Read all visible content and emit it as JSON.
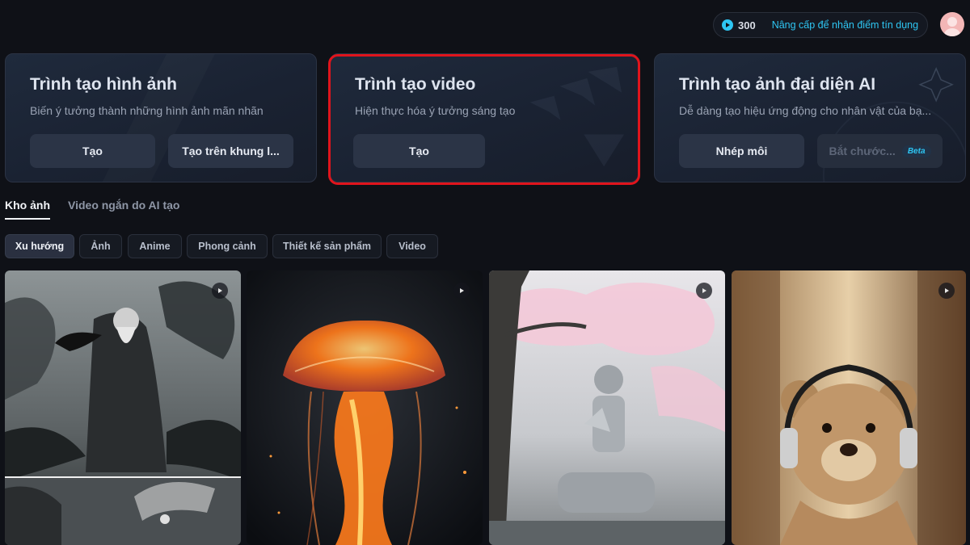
{
  "header": {
    "credits": "300",
    "upgrade_label": "Nâng cấp để nhận điểm tín dụng",
    "icons": {
      "credits": "play-circle-icon",
      "avatar": "user-avatar"
    }
  },
  "cards": [
    {
      "title": "Trình tạo hình ảnh",
      "description": "Biến ý tưởng thành những hình ảnh mãn nhãn",
      "buttons": [
        {
          "label": "Tạo"
        },
        {
          "label": "Tạo trên khung l..."
        }
      ]
    },
    {
      "title": "Trình tạo video",
      "description": "Hiện thực hóa ý tưởng sáng tạo",
      "buttons": [
        {
          "label": "Tạo"
        }
      ],
      "highlighted": true
    },
    {
      "title": "Trình tạo ảnh đại diện AI",
      "description": "Dễ dàng tạo hiệu ứng động cho nhân vật của bạ...",
      "buttons": [
        {
          "label": "Nhép môi"
        },
        {
          "label": "Bắt chước...",
          "badge": "Beta",
          "disabled": true
        }
      ]
    }
  ],
  "tabs": [
    {
      "label": "Kho ảnh",
      "active": true
    },
    {
      "label": "Video ngắn do AI tạo",
      "active": false
    }
  ],
  "filters": [
    {
      "label": "Xu hướng",
      "active": true
    },
    {
      "label": "Ảnh"
    },
    {
      "label": "Anime"
    },
    {
      "label": "Phong cảnh"
    },
    {
      "label": "Thiết kế sản phẩm"
    },
    {
      "label": "Video"
    }
  ],
  "gallery": [
    {
      "subject": "dark-fantasy-old-man-with-crow",
      "badge_icon": "play-icon"
    },
    {
      "subject": "fiery-jellyfish",
      "badge_icon": "play-icon"
    },
    {
      "subject": "robot-praying-under-cherry-blossom",
      "badge_icon": "play-icon"
    },
    {
      "subject": "teddy-bear-with-headphones",
      "badge_icon": "play-icon"
    }
  ],
  "colors": {
    "background": "#0f1117",
    "accent": "#2ec6f3",
    "highlight": "#e0141c",
    "card": "#1f2a3c"
  }
}
